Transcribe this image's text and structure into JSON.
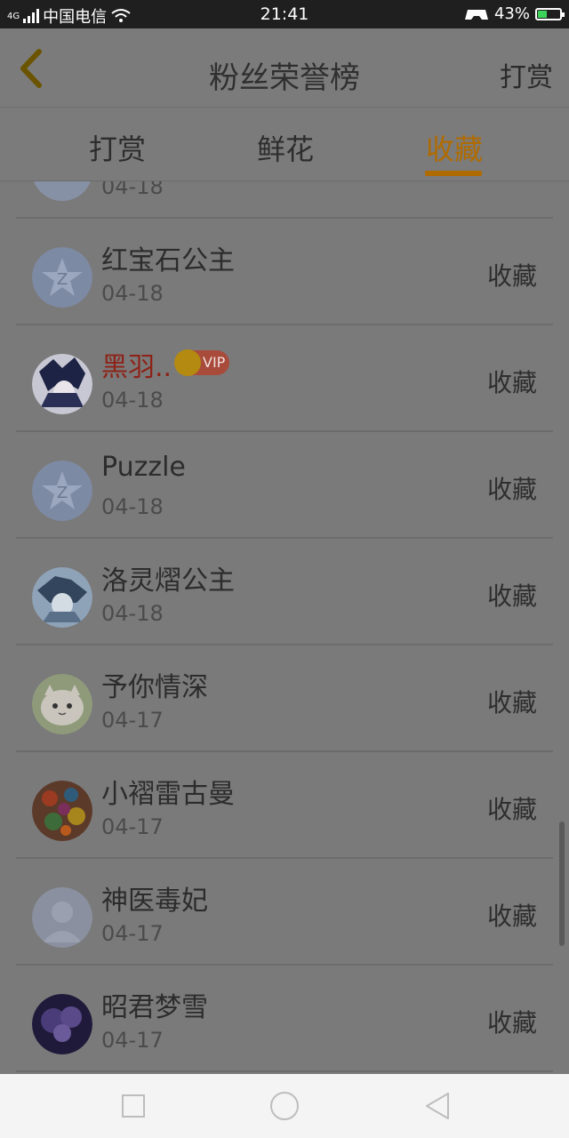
{
  "status": {
    "network": "4G",
    "carrier": "中国电信",
    "time": "21:41",
    "battery": "43%"
  },
  "header": {
    "title": "粉丝荣誉榜",
    "action": "打赏"
  },
  "tabs": [
    {
      "label": "打赏",
      "active": false
    },
    {
      "label": "鲜花",
      "active": false
    },
    {
      "label": "收藏",
      "active": true
    }
  ],
  "list": {
    "partial_date": "04-18",
    "rows": [
      {
        "name": "红宝石公主",
        "date": "04-18",
        "action": "收藏",
        "avatar": "default-star-avatar"
      },
      {
        "name": "黑羽..",
        "date": "04-18",
        "action": "收藏",
        "avatar": "anime-avatar",
        "vip_label": "VIP"
      },
      {
        "name": "Puzzle",
        "date": "04-18",
        "action": "收藏",
        "avatar": "default-star-avatar"
      },
      {
        "name": "洛灵熠公主",
        "date": "04-18",
        "action": "收藏",
        "avatar": "anime-avatar"
      },
      {
        "name": "予你情深",
        "date": "04-17",
        "action": "收藏",
        "avatar": "cat-avatar"
      },
      {
        "name": "小褶雷古曼",
        "date": "04-17",
        "action": "收藏",
        "avatar": "colorful-avatar"
      },
      {
        "name": "神医毒妃",
        "date": "04-17",
        "action": "收藏",
        "avatar": "default-person-avatar"
      },
      {
        "name": "昭君梦雪",
        "date": "04-17",
        "action": "收藏",
        "avatar": "night-avatar"
      }
    ]
  },
  "colors": {
    "accent": "#b06b00",
    "vip_name": "#8d2318"
  }
}
